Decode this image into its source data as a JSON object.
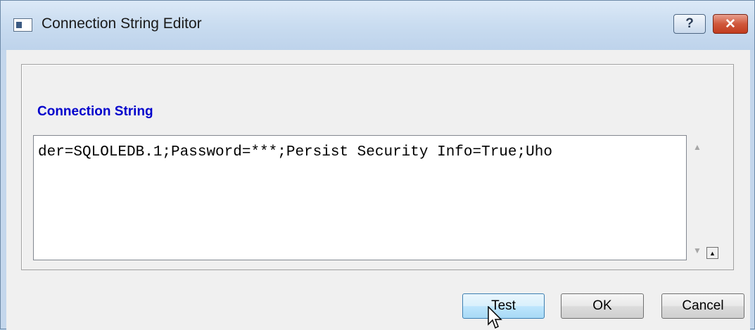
{
  "window": {
    "title": "Connection String Editor",
    "help_label": "?",
    "close_label": "✕"
  },
  "group": {
    "label": "Connection String"
  },
  "connection_string": {
    "value": "der=SQLOLEDB.1;Password=***;Persist Security Info=True;Uho"
  },
  "scrollbar": {
    "up_arrow": "▲",
    "down_arrow": "▼",
    "resize_glyph": "▲"
  },
  "buttons": {
    "test_label": "Test",
    "ok_label": "OK",
    "cancel_label": "Cancel"
  },
  "colors": {
    "group_label": "#0000cc",
    "close_button": "#c13c1f",
    "titlebar": "#c9dcf0"
  },
  "icons": {
    "window_icon": "app-window-icon",
    "cursor": "mouse-pointer-icon"
  }
}
